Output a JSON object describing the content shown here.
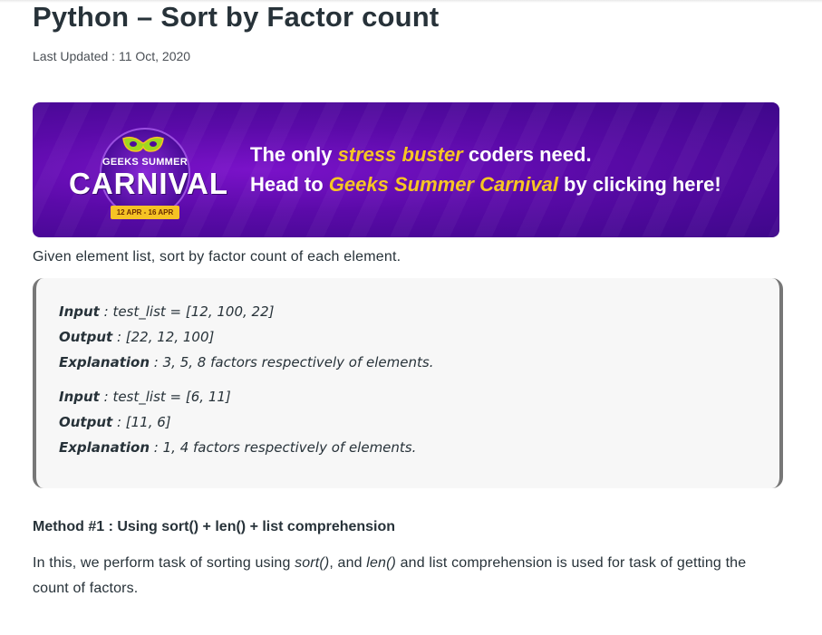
{
  "article": {
    "title": "Python – Sort by Factor count",
    "last_updated": "Last Updated : 11 Oct, 2020"
  },
  "banner": {
    "logo_top": "GEEKS SUMMER",
    "logo_main": "CARNIVAL",
    "logo_dates": "12 APR - 16 APR",
    "line1_pre": "The only ",
    "line1_hl": "stress buster",
    "line1_post": " coders need.",
    "line2_pre": "Head to ",
    "line2_hl": "Geeks Summer Carnival",
    "line2_post": " by clicking here!",
    "colors": {
      "background": "#5a0aa8",
      "highlight": "#f7c622"
    }
  },
  "intro": "Given element list, sort by factor count of each element.",
  "examples": [
    {
      "label": "Input",
      "value": " : test_list = [12, 100, 22]"
    },
    {
      "label": "Output",
      "value": " : [22, 12, 100]"
    },
    {
      "label": "Explanation",
      "value": " : 3, 5, 8 factors respectively of elements."
    },
    {
      "label": "Input",
      "value": " : test_list = [6, 11]"
    },
    {
      "label": "Output",
      "value": " : [11, 6]"
    },
    {
      "label": "Explanation",
      "value": " : 1, 4 factors respectively of elements."
    }
  ],
  "method": {
    "heading": "Method #1 : Using sort() + len() + list comprehension",
    "para_1": "In this, we perform task of sorting using ",
    "code_1": "sort()",
    "para_2": ", and ",
    "code_2": "len()",
    "para_3": " and list comprehension is used for task of getting the count of factors."
  }
}
